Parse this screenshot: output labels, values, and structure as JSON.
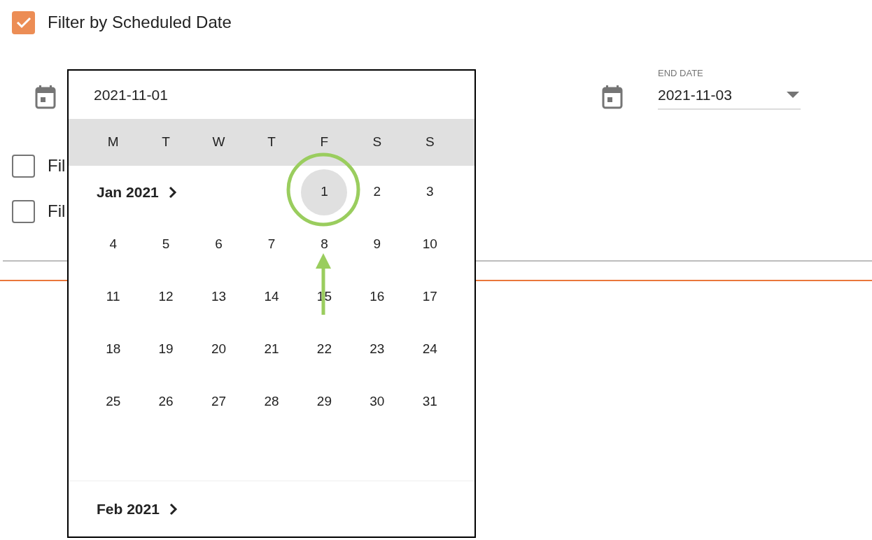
{
  "scheduled_filter": {
    "label": "Filter by Scheduled Date",
    "checked": true
  },
  "end_date": {
    "label": "END DATE",
    "value": "2021-11-03"
  },
  "other_filters": [
    {
      "label": "Fil",
      "checked": false
    },
    {
      "label": "Fil",
      "checked": false
    }
  ],
  "date_picker": {
    "value": "2021-11-01",
    "weekdays": [
      "M",
      "T",
      "W",
      "T",
      "F",
      "S",
      "S"
    ],
    "month": "Jan 2021",
    "weeks": [
      [
        {
          "label": "1",
          "selected": true
        },
        {
          "label": "2",
          "selected": false
        },
        {
          "label": "3",
          "selected": false
        }
      ],
      [
        {
          "label": "4",
          "selected": false
        },
        {
          "label": "5",
          "selected": false
        },
        {
          "label": "6",
          "selected": false
        },
        {
          "label": "7",
          "selected": false
        },
        {
          "label": "8",
          "selected": false
        },
        {
          "label": "9",
          "selected": false
        },
        {
          "label": "10",
          "selected": false
        }
      ],
      [
        {
          "label": "11",
          "selected": false
        },
        {
          "label": "12",
          "selected": false
        },
        {
          "label": "13",
          "selected": false
        },
        {
          "label": "14",
          "selected": false
        },
        {
          "label": "15",
          "selected": false
        },
        {
          "label": "16",
          "selected": false
        },
        {
          "label": "17",
          "selected": false
        }
      ],
      [
        {
          "label": "18",
          "selected": false
        },
        {
          "label": "19",
          "selected": false
        },
        {
          "label": "20",
          "selected": false
        },
        {
          "label": "21",
          "selected": false
        },
        {
          "label": "22",
          "selected": false
        },
        {
          "label": "23",
          "selected": false
        },
        {
          "label": "24",
          "selected": false
        }
      ],
      [
        {
          "label": "25",
          "selected": false
        },
        {
          "label": "26",
          "selected": false
        },
        {
          "label": "27",
          "selected": false
        },
        {
          "label": "28",
          "selected": false
        },
        {
          "label": "29",
          "selected": false
        },
        {
          "label": "30",
          "selected": false
        },
        {
          "label": "31",
          "selected": false
        }
      ]
    ],
    "next_month": "Feb 2021"
  }
}
